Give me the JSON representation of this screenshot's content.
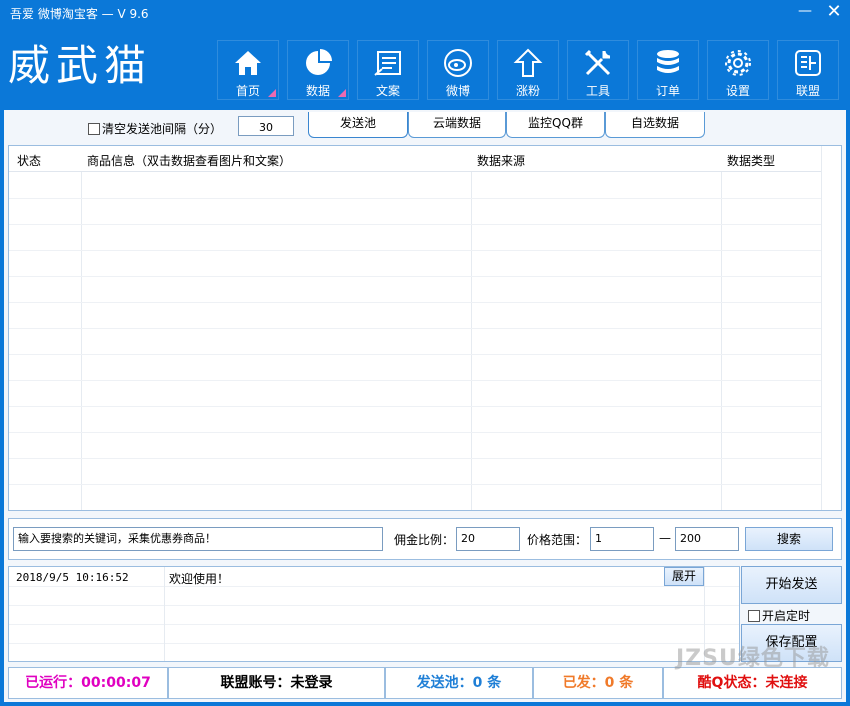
{
  "window": {
    "title": "吾爱 微博淘宝客 — V 9.6",
    "minimize": "—",
    "close": "✕"
  },
  "logo": "威武猫",
  "nav": [
    {
      "label": "首页",
      "icon": "home-icon",
      "menu": true
    },
    {
      "label": "数据",
      "icon": "pie-chart-icon",
      "menu": true
    },
    {
      "label": "文案",
      "icon": "document-icon",
      "menu": false
    },
    {
      "label": "微博",
      "icon": "weibo-icon",
      "menu": false
    },
    {
      "label": "涨粉",
      "icon": "arrow-up-icon",
      "menu": false
    },
    {
      "label": "工具",
      "icon": "tools-icon",
      "menu": false
    },
    {
      "label": "订单",
      "icon": "database-icon",
      "menu": false
    },
    {
      "label": "设置",
      "icon": "gear-icon",
      "menu": false
    },
    {
      "label": "联盟",
      "icon": "alliance-icon",
      "menu": false
    }
  ],
  "pool_option": {
    "checkbox_label": "清空发送池间隔（分）",
    "interval_value": "30"
  },
  "tabs": [
    "发送池",
    "云端数据",
    "监控QQ群",
    "自选数据"
  ],
  "table": {
    "columns": [
      "状态",
      "商品信息（双击数据查看图片和文案）",
      "数据来源",
      "数据类型"
    ]
  },
  "search": {
    "keyword_value": "输入要搜索的关键词，采集优惠券商品！",
    "commission_label": "佣金比例：",
    "commission_value": "20",
    "price_label": "价格范围：",
    "price_min": "1",
    "price_sep": "—",
    "price_max": "200",
    "search_button": "搜索"
  },
  "log": {
    "entries": [
      {
        "time": "2018/9/5 10:16:52",
        "message": "欢迎使用！"
      }
    ],
    "expand_button": "展开"
  },
  "actions": {
    "start_send": "开始发送",
    "timer_label": "开启定时",
    "save_config": "保存配置"
  },
  "status_bar": {
    "running": "已运行：00:00:07",
    "account": "联盟账号：未登录",
    "pool": "发送池：0 条",
    "sent": "已发：0 条",
    "qq_status": "酷Q状态：未连接"
  },
  "colors": {
    "header_bg": "#0b78d8",
    "running": "#e000c0",
    "pool": "#1f7fd6",
    "sent": "#f07a2a",
    "qq_status": "#e01010"
  },
  "watermark": "JZSU绿色下载"
}
